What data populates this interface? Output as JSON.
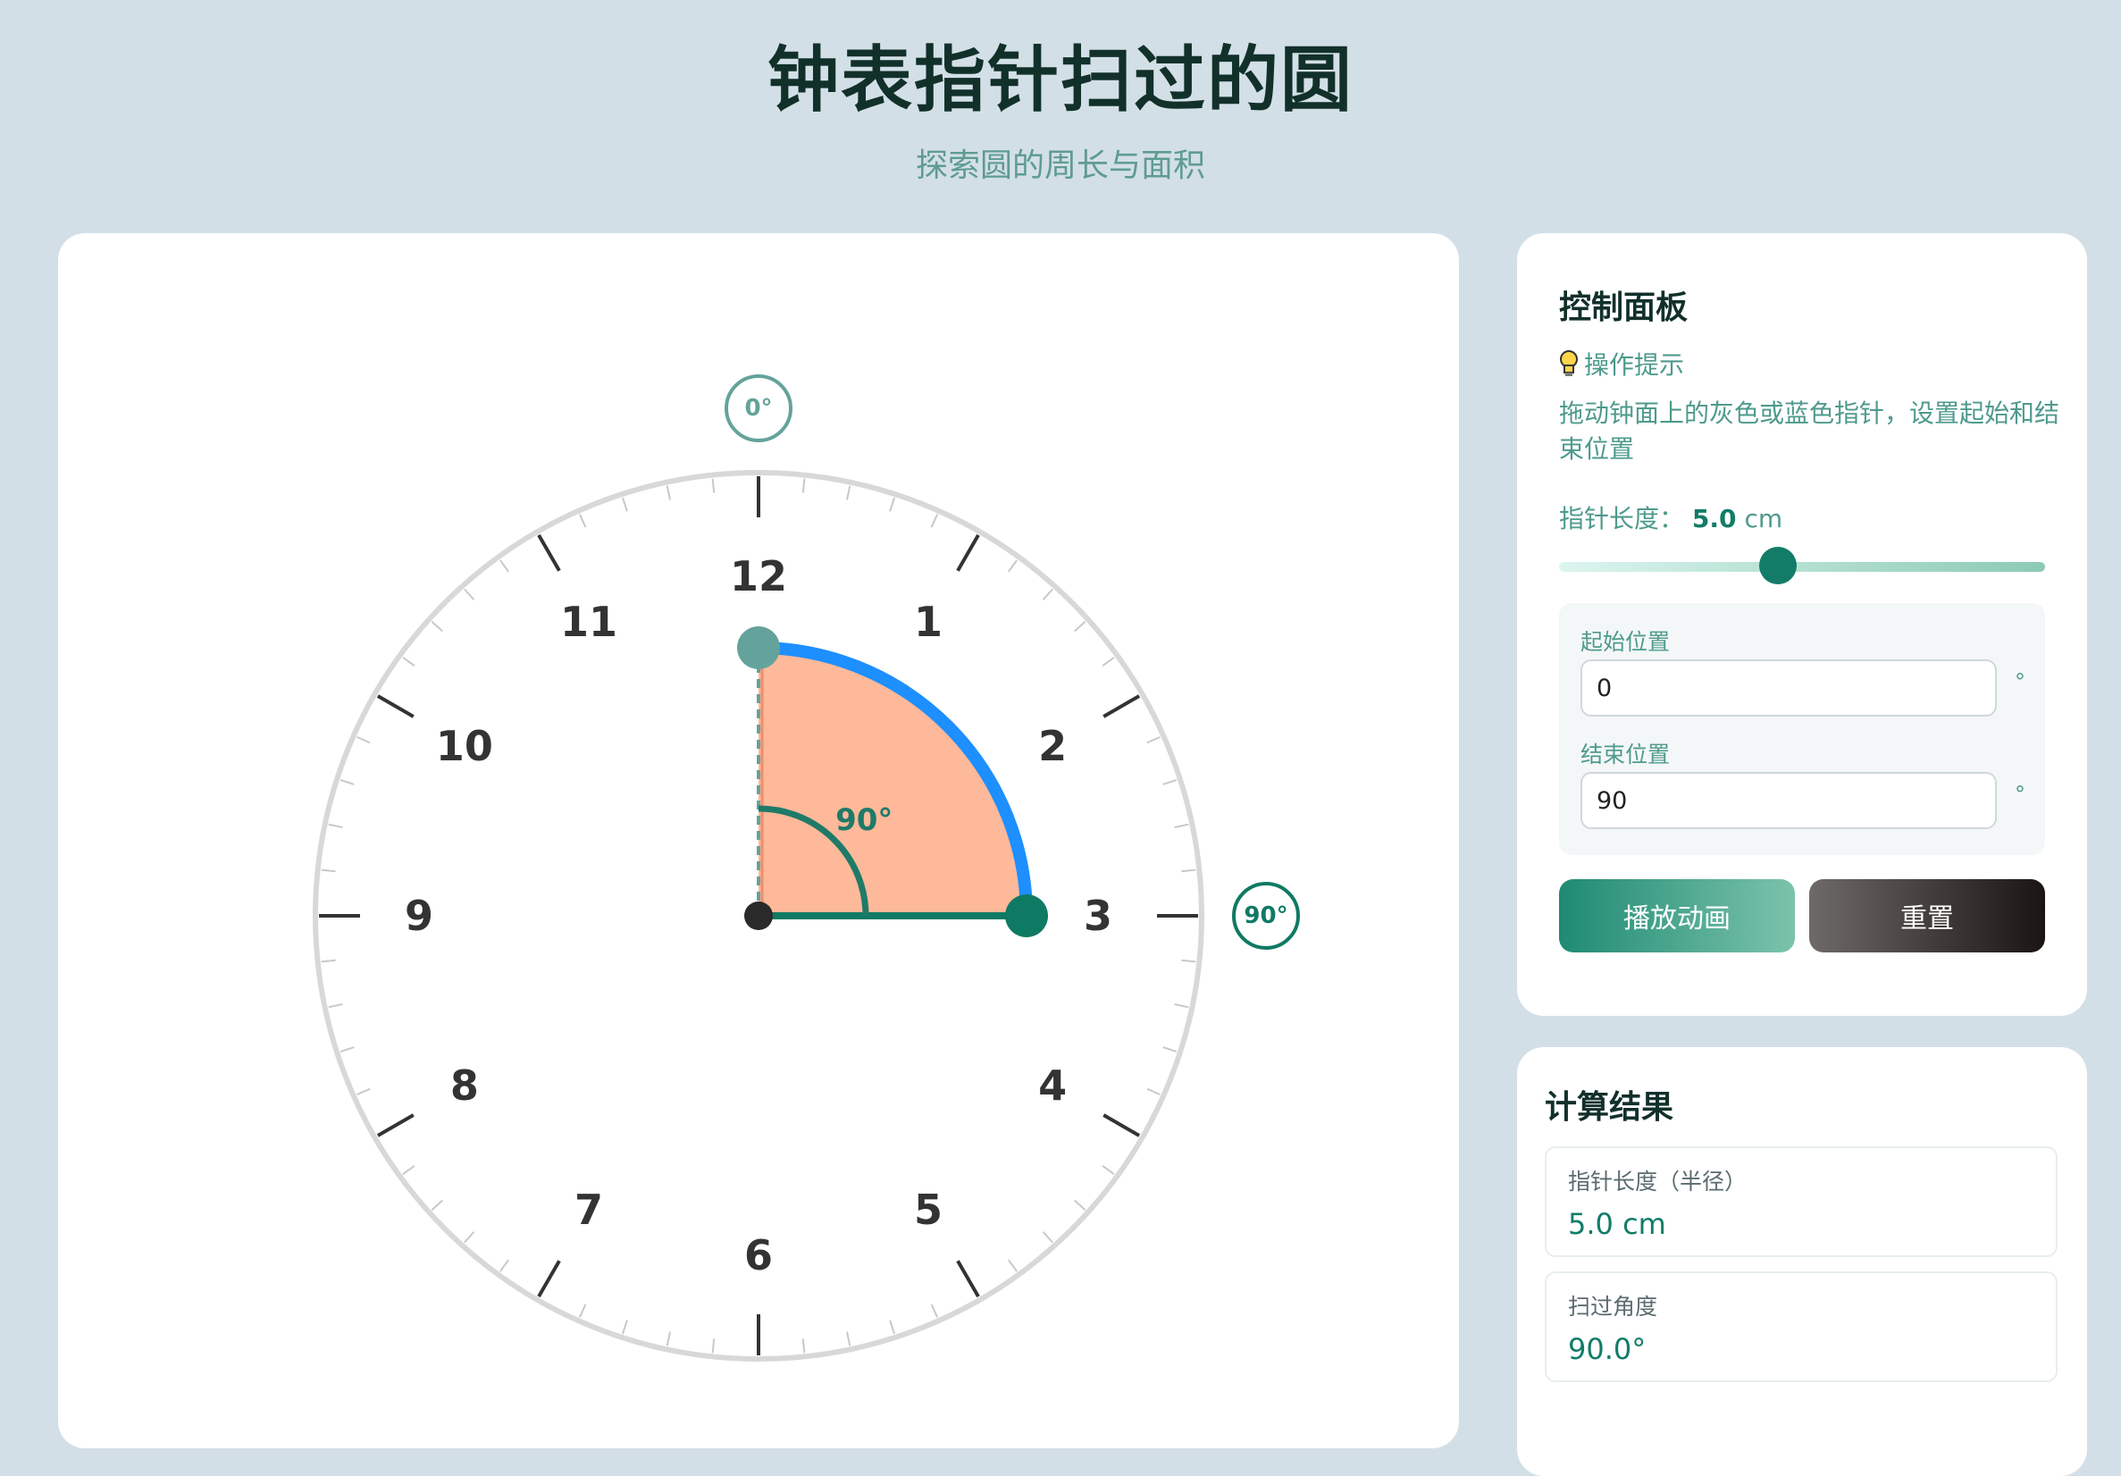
{
  "header": {
    "title": "钟表指针扫过的圆",
    "subtitle": "探索圆的周长与面积"
  },
  "clock": {
    "numbers": [
      "12",
      "1",
      "2",
      "3",
      "4",
      "5",
      "6",
      "7",
      "8",
      "9",
      "10",
      "11"
    ],
    "start_marker": "0°",
    "end_marker": "90°",
    "angle_label": "90°",
    "start_angle_deg": 0,
    "end_angle_deg": 90,
    "colors": {
      "sector_fill": "#fdb99a",
      "arc": "#1e8fff",
      "start_hand": "#64a39b",
      "end_hand": "#0f7a63",
      "angle_arc": "#1f7a68",
      "rim": "#d8d8d8"
    }
  },
  "panel": {
    "title": "控制面板",
    "tip_label": "操作提示",
    "tip_text": "拖动钟面上的灰色或蓝色指针，设置起始和结束位置",
    "length_label": "指针长度：",
    "length_value": "5.0",
    "length_unit": "cm",
    "slider_fraction": 0.45,
    "start_label": "起始位置",
    "start_value": "0",
    "end_label": "结束位置",
    "end_value": "90",
    "degree_symbol": "°",
    "play_button": "播放动画",
    "reset_button": "重置"
  },
  "results": {
    "title": "计算结果",
    "items": [
      {
        "label": "指针长度（半径）",
        "value": "5.0 cm"
      },
      {
        "label": "扫过角度",
        "value": "90.0°"
      }
    ]
  }
}
